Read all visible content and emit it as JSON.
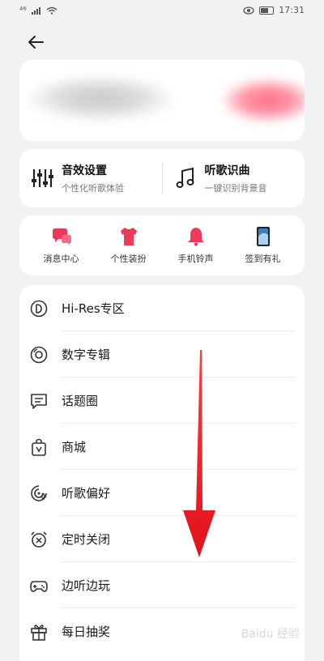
{
  "status_bar": {
    "network": "⁴⁶",
    "time": "17:31"
  },
  "features": [
    {
      "title": "音效设置",
      "subtitle": "个性化听歌体验",
      "icon": "equalizer-icon"
    },
    {
      "title": "听歌识曲",
      "subtitle": "一键识别背景音",
      "icon": "music-note-icon"
    }
  ],
  "shortcuts": [
    {
      "label": "消息中心",
      "icon": "message-icon"
    },
    {
      "label": "个性装扮",
      "icon": "tshirt-icon"
    },
    {
      "label": "手机铃声",
      "icon": "bell-icon"
    },
    {
      "label": "签到有礼",
      "icon": "phone-icon"
    }
  ],
  "menu": [
    {
      "label": "Hi-Res专区",
      "icon": "hires-icon"
    },
    {
      "label": "数字专辑",
      "icon": "disc-icon"
    },
    {
      "label": "话题圈",
      "icon": "chat-icon"
    },
    {
      "label": "商城",
      "icon": "shopping-bag-icon"
    },
    {
      "label": "听歌偏好",
      "icon": "preference-icon"
    },
    {
      "label": "定时关闭",
      "icon": "alarm-icon"
    },
    {
      "label": "边听边玩",
      "icon": "gamepad-icon"
    },
    {
      "label": "每日抽奖",
      "icon": "gift-icon"
    }
  ],
  "watermark": "Baidu 经验",
  "colors": {
    "accent": "#ee3a58",
    "arrow": "#ee1c25"
  }
}
